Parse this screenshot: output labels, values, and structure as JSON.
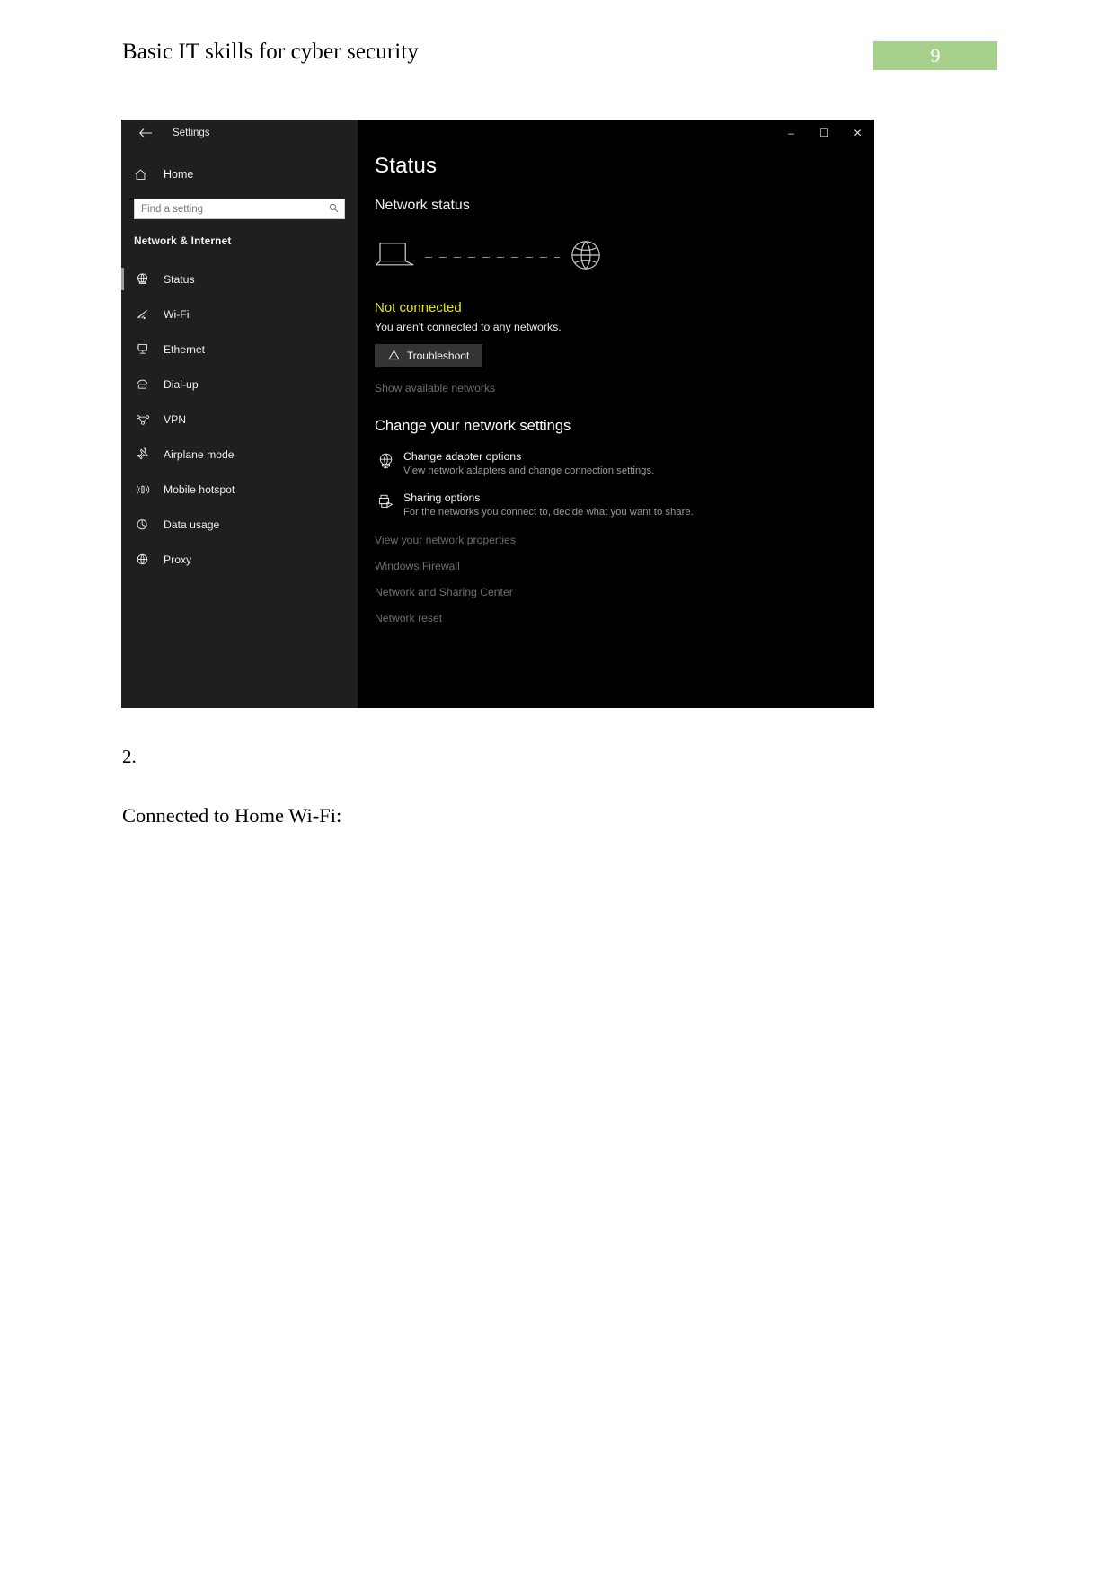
{
  "document": {
    "header_title": "Basic IT skills for cyber security",
    "page_number": "9",
    "page_badge_color": "#a8d08d",
    "step_number": "2.",
    "caption": "Connected to Home Wi-Fi:"
  },
  "window": {
    "app_title": "Settings",
    "back_icon": "back-arrow-icon",
    "controls": {
      "minimize": "–",
      "maximize": "☐",
      "close": "✕"
    }
  },
  "sidebar": {
    "home_label": "Home",
    "home_icon": "home-icon",
    "search": {
      "placeholder": "Find a setting",
      "value": "",
      "icon": "search-icon"
    },
    "section_title": "Network & Internet",
    "items": [
      {
        "label": "Status",
        "icon": "status-globe-icon",
        "selected": true
      },
      {
        "label": "Wi-Fi",
        "icon": "wifi-icon",
        "selected": false
      },
      {
        "label": "Ethernet",
        "icon": "ethernet-icon",
        "selected": false
      },
      {
        "label": "Dial-up",
        "icon": "dial-up-icon",
        "selected": false
      },
      {
        "label": "VPN",
        "icon": "vpn-icon",
        "selected": false
      },
      {
        "label": "Airplane mode",
        "icon": "airplane-icon",
        "selected": false
      },
      {
        "label": "Mobile hotspot",
        "icon": "mobile-hotspot-icon",
        "selected": false
      },
      {
        "label": "Data usage",
        "icon": "data-usage-icon",
        "selected": false
      },
      {
        "label": "Proxy",
        "icon": "proxy-globe-icon",
        "selected": false
      }
    ]
  },
  "main": {
    "page_title": "Status",
    "network_status_heading": "Network status",
    "diagram": {
      "device_icon": "laptop-icon",
      "target_icon": "globe-icon",
      "link_style": "dashed-disconnected"
    },
    "connection": {
      "state_text": "Not connected",
      "state_color": "#e6e600",
      "detail_text": "You aren't connected to any networks.",
      "troubleshoot_button": "Troubleshoot",
      "troubleshoot_icon": "warning-triangle-icon",
      "show_networks_link": "Show available networks"
    },
    "change_settings_heading": "Change your network settings",
    "options": [
      {
        "title": "Change adapter options",
        "desc": "View network adapters and change connection settings.",
        "icon": "adapter-globe-icon"
      },
      {
        "title": "Sharing options",
        "desc": "For the networks you connect to, decide what you want to share.",
        "icon": "sharing-printer-icon"
      }
    ],
    "links": [
      "View your network properties",
      "Windows Firewall",
      "Network and Sharing Center",
      "Network reset"
    ]
  }
}
